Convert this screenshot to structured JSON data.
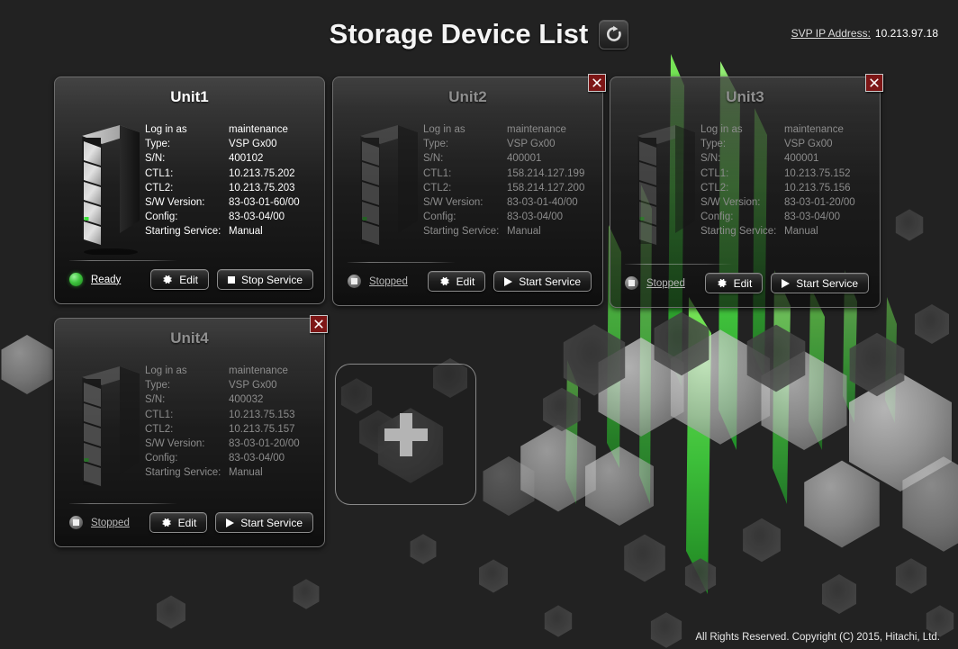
{
  "header": {
    "title": "Storage Device List",
    "refresh_icon": "refresh-icon",
    "svp_label": "SVP IP Address:",
    "svp_value": "10.213.97.18"
  },
  "spec_keys": {
    "login": "Log in as",
    "type": "Type:",
    "sn": "S/N:",
    "ctl1": "CTL1:",
    "ctl2": "CTL2:",
    "sw": "S/W Version:",
    "config": "Config:",
    "start": "Starting Service:"
  },
  "labels": {
    "edit": "Edit",
    "start_service": "Start Service",
    "stop_service": "Stop Service",
    "close": "×",
    "add": "+"
  },
  "colors": {
    "background": "#222222",
    "card_border": "#6e6e6e",
    "close_red": "#7d1616",
    "led_ready_green": "#3fc53f",
    "led_stopped_grey": "#7c7c7c",
    "accent_green": "#3ec73e",
    "text_primary": "#ffffff",
    "text_dim": "#8c8c8c"
  },
  "units": [
    {
      "name": "Unit1",
      "active": true,
      "closable": false,
      "login": "maintenance",
      "type": "VSP Gx00",
      "sn": "400102",
      "ctl1": "10.213.75.202",
      "ctl2": "10.213.75.203",
      "sw": "83-03-01-60/00",
      "config": "83-03-04/00",
      "start": "Manual",
      "status": "Ready",
      "status_kind": "ready",
      "service_action": "Stop Service",
      "service_kind": "stop"
    },
    {
      "name": "Unit2",
      "active": false,
      "closable": true,
      "login": "maintenance",
      "type": "VSP Gx00",
      "sn": "400001",
      "ctl1": "158.214.127.199",
      "ctl2": "158.214.127.200",
      "sw": "83-03-01-40/00",
      "config": "83-03-04/00",
      "start": "Manual",
      "status": "Stopped",
      "status_kind": "stopped",
      "service_action": "Start Service",
      "service_kind": "start"
    },
    {
      "name": "Unit3",
      "active": false,
      "closable": true,
      "login": "maintenance",
      "type": "VSP Gx00",
      "sn": "400001",
      "ctl1": "10.213.75.152",
      "ctl2": "10.213.75.156",
      "sw": "83-03-01-20/00",
      "config": "83-03-04/00",
      "start": "Manual",
      "status": "Stopped",
      "status_kind": "stopped",
      "service_action": "Start Service",
      "service_kind": "start"
    },
    {
      "name": "Unit4",
      "active": false,
      "closable": true,
      "login": "maintenance",
      "type": "VSP Gx00",
      "sn": "400032",
      "ctl1": "10.213.75.153",
      "ctl2": "10.213.75.157",
      "sw": "83-03-01-20/00",
      "config": "83-03-04/00",
      "start": "Manual",
      "status": "Stopped",
      "status_kind": "stopped",
      "service_action": "Start Service",
      "service_kind": "start"
    }
  ],
  "footer": {
    "copyright": "All Rights Reserved. Copyright (C) 2015, Hitachi, Ltd."
  }
}
